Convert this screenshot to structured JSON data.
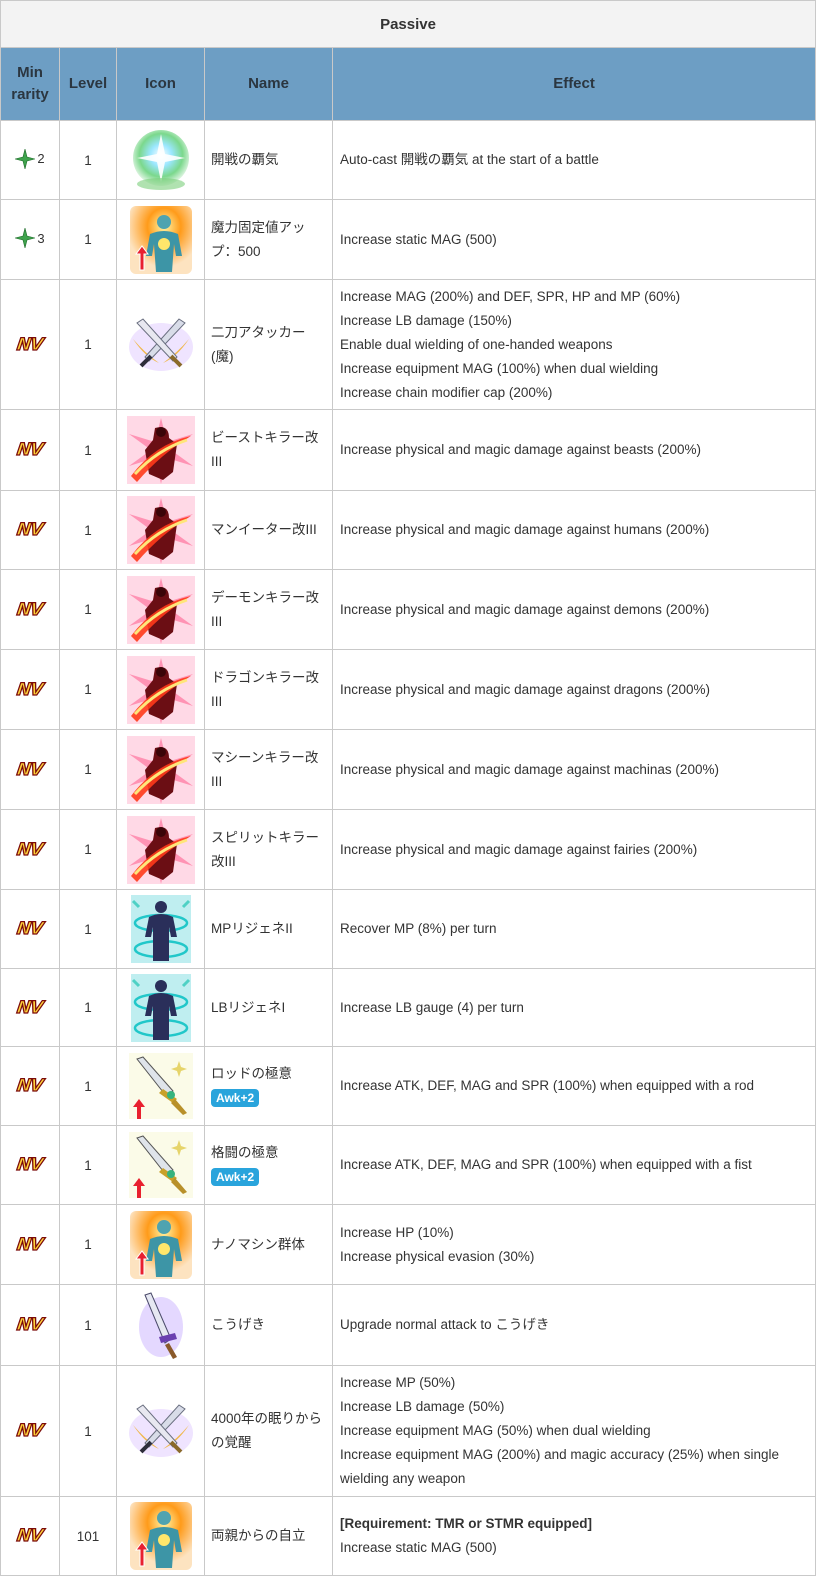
{
  "title": "Passive",
  "headers": {
    "rarity": "Min rarity",
    "level": "Level",
    "icon": "Icon",
    "name": "Name",
    "effect": "Effect"
  },
  "rows": [
    {
      "rarity": "2",
      "level": "1",
      "name": "開戦の覇気",
      "effects": [
        "Auto-cast 開戦の覇気 at the start of a battle"
      ],
      "icon": "green-orb-icon"
    },
    {
      "rarity": "3",
      "level": "1",
      "name": "魔力固定値アップ：500",
      "effects": [
        "Increase static MAG (500)"
      ],
      "icon": "stat-up-figure-icon"
    },
    {
      "rarity": "NV",
      "level": "1",
      "name": "二刀アタッカー(魔)",
      "effects": [
        "Increase MAG (200%) and DEF, SPR, HP and MP (60%)",
        "Increase LB damage (150%)",
        "Enable dual wielding of one-handed weapons",
        "Increase equipment MAG (100%) when dual wielding",
        "Increase chain modifier cap (200%)"
      ],
      "icon": "dual-swords-icon"
    },
    {
      "rarity": "NV",
      "level": "1",
      "name": "ビーストキラー改III",
      "effects": [
        "Increase physical and magic damage against beasts (200%)"
      ],
      "icon": "killer-slash-icon"
    },
    {
      "rarity": "NV",
      "level": "1",
      "name": "マンイーター改III",
      "effects": [
        "Increase physical and magic damage against humans (200%)"
      ],
      "icon": "killer-slash-icon"
    },
    {
      "rarity": "NV",
      "level": "1",
      "name": "デーモンキラー改III",
      "effects": [
        "Increase physical and magic damage against demons (200%)"
      ],
      "icon": "killer-slash-icon"
    },
    {
      "rarity": "NV",
      "level": "1",
      "name": "ドラゴンキラー改III",
      "effects": [
        "Increase physical and magic damage against dragons (200%)"
      ],
      "icon": "killer-slash-icon"
    },
    {
      "rarity": "NV",
      "level": "1",
      "name": "マシーンキラー改III",
      "effects": [
        "Increase physical and magic damage against machinas (200%)"
      ],
      "icon": "killer-slash-icon"
    },
    {
      "rarity": "NV",
      "level": "1",
      "name": "スピリットキラー改III",
      "effects": [
        "Increase physical and magic damage against fairies (200%)"
      ],
      "icon": "killer-slash-icon"
    },
    {
      "rarity": "NV",
      "level": "1",
      "name": "MPリジェネII",
      "effects": [
        "Recover MP (8%) per turn"
      ],
      "icon": "regen-figure-icon"
    },
    {
      "rarity": "NV",
      "level": "1",
      "name": "LBリジェネI",
      "effects": [
        "Increase LB gauge (4) per turn"
      ],
      "icon": "regen-figure-icon"
    },
    {
      "rarity": "NV",
      "level": "1",
      "name": "ロッドの極意",
      "badge": "Awk+2",
      "effects": [
        "Increase ATK, DEF, MAG and SPR (100%) when equipped with a rod"
      ],
      "icon": "sword-up-icon"
    },
    {
      "rarity": "NV",
      "level": "1",
      "name": "格闘の極意",
      "badge": "Awk+2",
      "effects": [
        "Increase ATK, DEF, MAG and SPR (100%) when equipped with a fist"
      ],
      "icon": "sword-up-icon"
    },
    {
      "rarity": "NV",
      "level": "1",
      "name": "ナノマシン群体",
      "effects": [
        "Increase HP (10%)",
        "Increase physical evasion (30%)"
      ],
      "icon": "stat-up-figure-icon"
    },
    {
      "rarity": "NV",
      "level": "1",
      "name": "こうげき",
      "effects": [
        "Upgrade normal attack to こうげき"
      ],
      "icon": "purple-sword-icon"
    },
    {
      "rarity": "NV",
      "level": "1",
      "name": "4000年の眠りからの覚醒",
      "effects": [
        "Increase MP (50%)",
        "Increase LB damage (50%)",
        "Increase equipment MAG (50%) when dual wielding",
        "Increase equipment MAG (200%) and magic accuracy (25%) when single wielding any weapon"
      ],
      "icon": "dual-swords-icon"
    },
    {
      "rarity": "NV",
      "level": "101",
      "name": "両親からの自立",
      "requirement": "[Requirement: TMR or STMR equipped]",
      "effects": [
        "Increase static MAG (500)"
      ],
      "icon": "stat-up-figure-icon"
    }
  ]
}
